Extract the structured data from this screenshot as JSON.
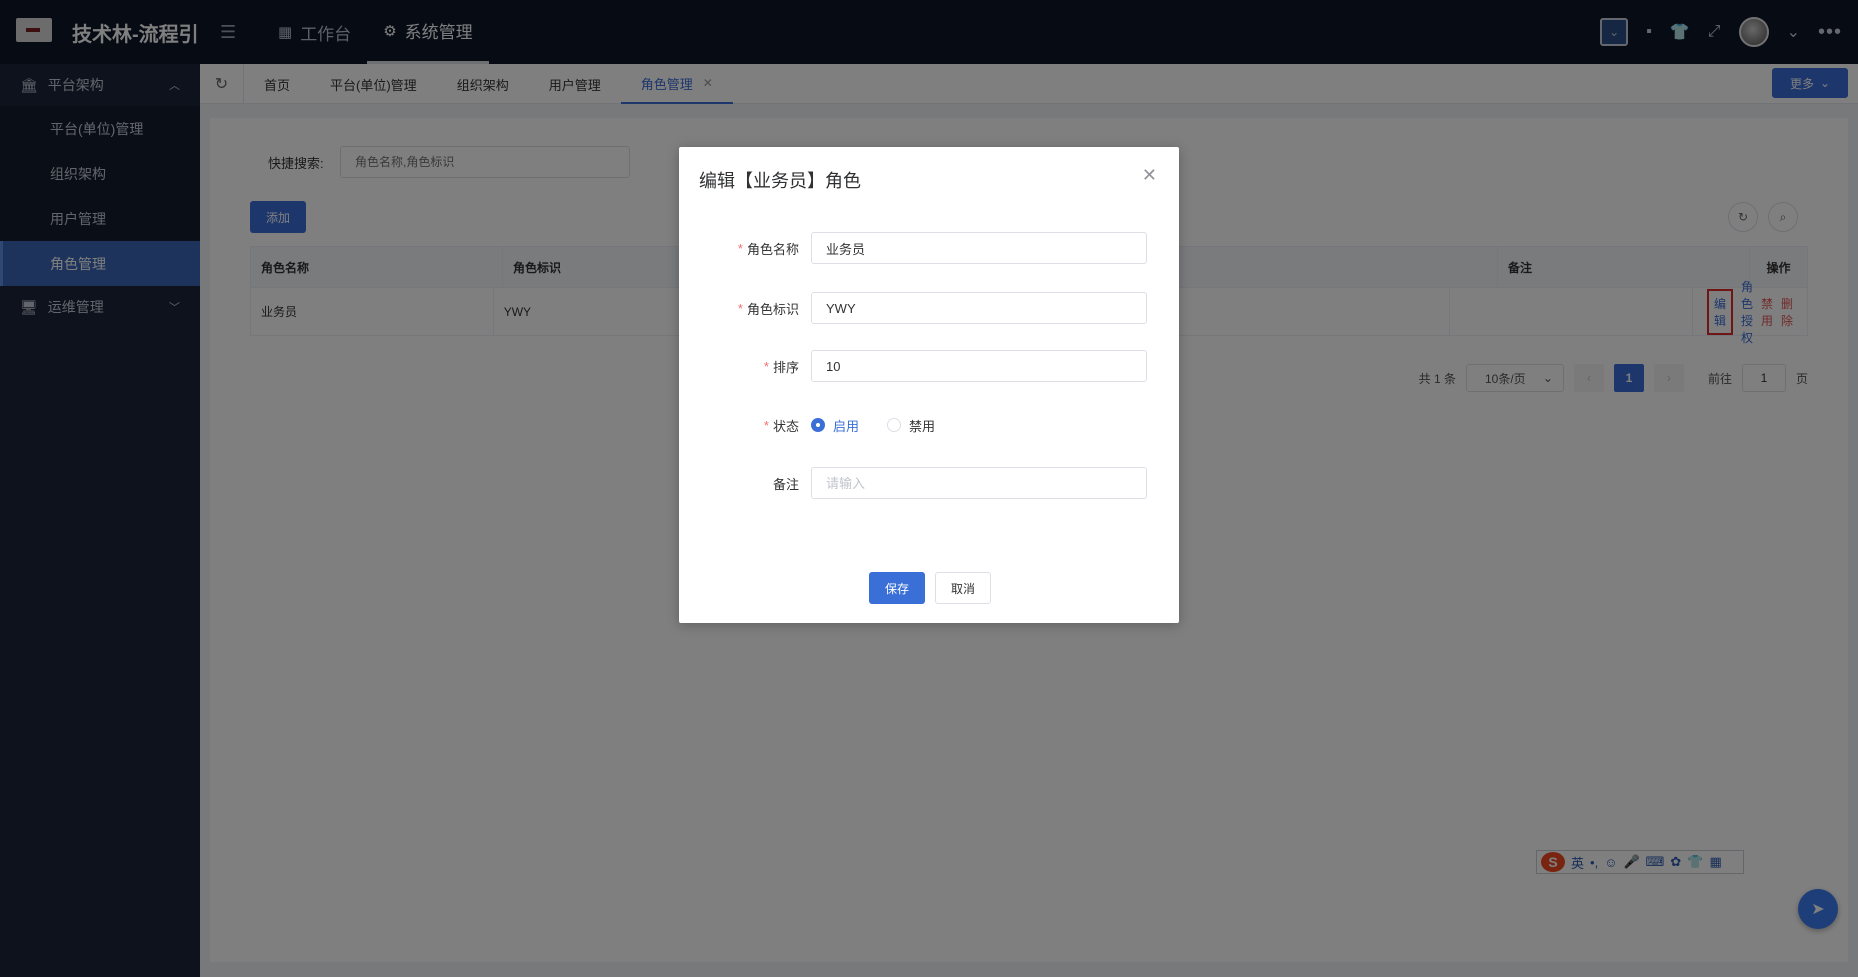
{
  "app": {
    "title": "技术林-流程引"
  },
  "top_nav": [
    {
      "label": "工作台",
      "icon": "grid-icon"
    },
    {
      "label": "系统管理",
      "icon": "gear-icon"
    }
  ],
  "sidebar": {
    "group1": {
      "label": "平台架构"
    },
    "items": [
      {
        "label": "平台(单位)管理"
      },
      {
        "label": "组织架构"
      },
      {
        "label": "用户管理"
      },
      {
        "label": "角色管理"
      }
    ],
    "group2": {
      "label": "运维管理"
    }
  },
  "tabs": [
    {
      "label": "首页"
    },
    {
      "label": "平台(单位)管理"
    },
    {
      "label": "组织架构"
    },
    {
      "label": "用户管理"
    },
    {
      "label": "角色管理"
    }
  ],
  "more_button": "更多",
  "search": {
    "label": "快捷搜索:",
    "placeholder": "角色名称,角色标识"
  },
  "add_button": "添加",
  "table": {
    "headers": [
      "角色名称",
      "角色标识",
      "",
      "备注",
      "操作"
    ],
    "rows": [
      {
        "name": "业务员",
        "code": "YWY",
        "remark": ""
      }
    ],
    "actions": {
      "edit": "编辑",
      "auth": "角色授权",
      "disable": "禁用",
      "delete": "删除"
    }
  },
  "pager": {
    "total": "共 1 条",
    "page_size": "10条/页",
    "current": "1",
    "goto_label": "前往",
    "goto_value": "1",
    "page_unit": "页"
  },
  "dialog": {
    "title": "编辑【业务员】角色",
    "fields": {
      "name": {
        "label": "角色名称",
        "value": "业务员"
      },
      "code": {
        "label": "角色标识",
        "value": "YWY"
      },
      "sort": {
        "label": "排序",
        "value": "10"
      },
      "status": {
        "label": "状态",
        "options": [
          "启用",
          "禁用"
        ],
        "selected": "启用"
      },
      "remark": {
        "label": "备注",
        "placeholder": "请输入"
      }
    },
    "save": "保存",
    "cancel": "取消"
  },
  "ime": {
    "lang": "英"
  },
  "colors": {
    "primary": "#3a6fd8",
    "topbar": "#0d1629",
    "sidebar": "#1b2438",
    "danger": "#e15656"
  }
}
